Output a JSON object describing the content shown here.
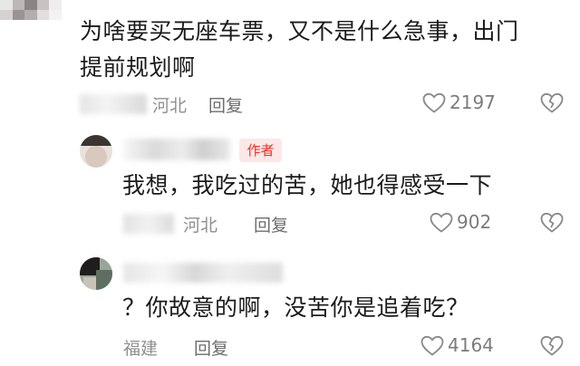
{
  "comments": [
    {
      "text_line1": "为啥要买无座车票，又不是什么急事，出门",
      "text_line2": "提前规划啊",
      "location": "河北",
      "reply_label": "回复",
      "likes": "2197"
    },
    {
      "author_badge": "作者",
      "text": "我想，我吃过的苦，她也得感受一下",
      "location": "河北",
      "reply_label": "回复",
      "likes": "902"
    },
    {
      "text": "？你故意的啊，没苦你是追着吃？",
      "location": "福建",
      "reply_label": "回复",
      "likes": "4164"
    }
  ],
  "icons": {
    "like": "heart-icon",
    "dislike": "broken-heart-icon"
  },
  "colors": {
    "badge_bg": "#fde7e7",
    "badge_text": "#e6332a",
    "meta_text": "#8f8f8f"
  }
}
